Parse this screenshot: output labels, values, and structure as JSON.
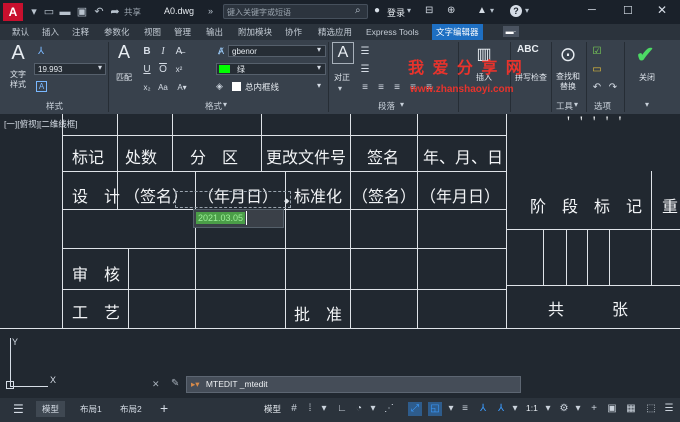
{
  "titlebar": {
    "logo": "A",
    "share_label": "共享",
    "filename": "A0.dwg",
    "search_placeholder": "键入关键字或短语",
    "login_label": "登录"
  },
  "tabs": [
    "默认",
    "插入",
    "注释",
    "参数化",
    "视图",
    "管理",
    "输出",
    "附加模块",
    "协作",
    "精选应用",
    "Express Tools",
    "文字编辑器"
  ],
  "active_tab": "文字编辑器",
  "ribbon": {
    "style_panel": {
      "title": "样式",
      "text_style_label": "文字\n样式",
      "height_value": "19.993",
      "annotative_icon": "A"
    },
    "format_panel": {
      "title": "格式",
      "match_label": "匹配",
      "font_value": "gbenor",
      "color_value": "绿",
      "color_swatch": "#00ff00",
      "mask_label": "总内框线"
    },
    "paragraph_panel": {
      "title": "段落",
      "justify_label": "对正"
    },
    "insert_panel": {
      "insert_label": "插入"
    },
    "spell_panel": {
      "spell_label": "拼写检查",
      "abc": "ABC"
    },
    "tools_panel": {
      "title": "工具",
      "find_label": "查找和\n替换"
    },
    "options_panel": {
      "title": "选项"
    },
    "close_panel": {
      "close_label": "关闭"
    }
  },
  "watermark": {
    "cn": "我 爱 分 享 网",
    "url": "www.zhanshaoyi.com"
  },
  "viewport_label": "[一][俯视][二维线框]",
  "table": {
    "row1": [
      "标记",
      "处数",
      "分　区",
      "更改文件号",
      "签名",
      "年、月、日"
    ],
    "row2": [
      "设　计",
      "（签名）",
      "（年月日）",
      "标准化",
      "（签名）",
      "（年月日）"
    ],
    "row4_label": "审　核",
    "row5_label": "工　艺",
    "row5_sign": "批　准",
    "right_stage": "阶　段　标　记",
    "right_weight": "重",
    "right_total": "共",
    "right_sheets": "张",
    "edit_text": "2021.03.05"
  },
  "ucs": {
    "y": "Y",
    "x": "X"
  },
  "command_line": {
    "text": "MTEDIT _mtedit"
  },
  "statusbar": {
    "layouts": [
      "模型",
      "布局1",
      "布局2"
    ],
    "active_layout": "模型",
    "model_label": "模型",
    "scale_label": "1:1"
  }
}
